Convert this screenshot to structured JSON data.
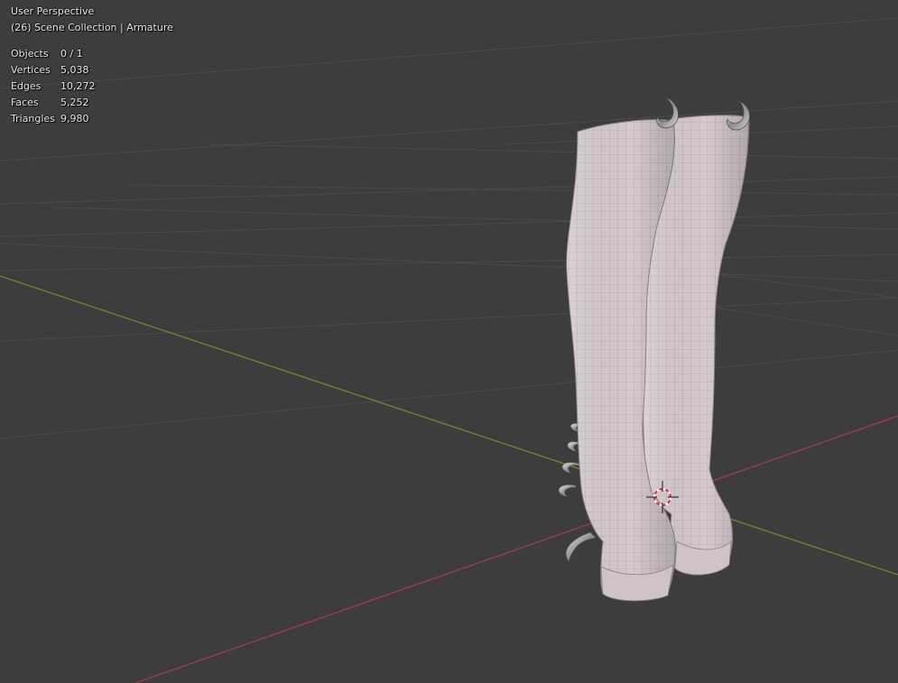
{
  "viewport": {
    "view_name": "User Perspective",
    "collection_line": "(26) Scene Collection | Armature",
    "background_color": "#3d3d3d",
    "grid_color": "#4a4a4a",
    "x_axis_color": "#a23b4a",
    "y_axis_color": "#6b8c2a"
  },
  "stats": [
    {
      "label": "Objects",
      "value": "0 / 1"
    },
    {
      "label": "Vertices",
      "value": "5,038"
    },
    {
      "label": "Edges",
      "value": "10,272"
    },
    {
      "label": "Faces",
      "value": "5,252"
    },
    {
      "label": "Triangles",
      "value": "9,980"
    }
  ],
  "model": {
    "icon": "boots-mesh",
    "mesh_color": "#d9cdd3",
    "wire_color": "#9e9099",
    "spike_color": "#b8b8b8"
  },
  "cursor": {
    "icon": "3d-cursor-icon",
    "colors": [
      "#e03030",
      "#ffffff"
    ]
  }
}
